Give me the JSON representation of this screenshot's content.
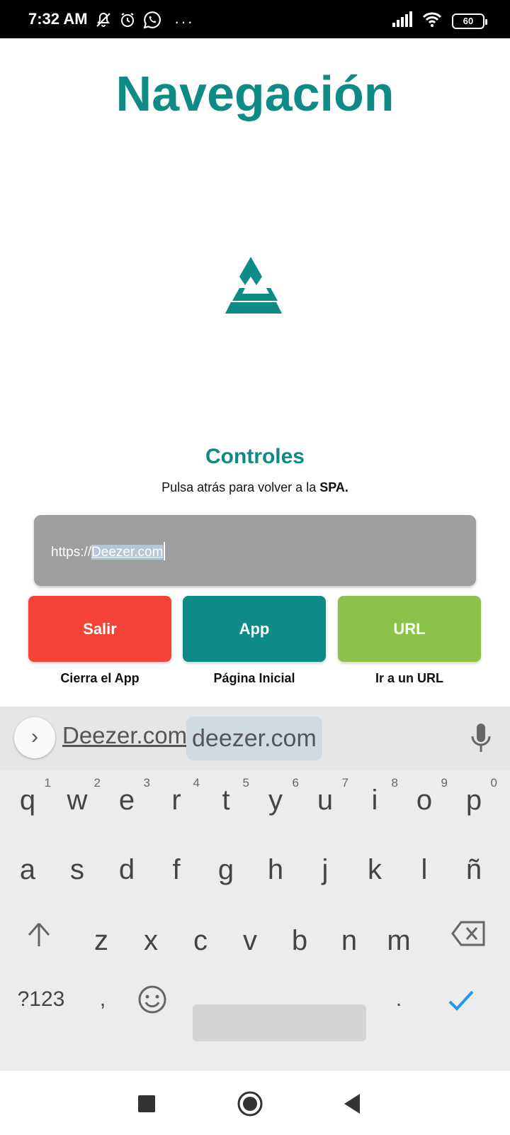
{
  "status_bar": {
    "time": "7:32 AM",
    "battery": "60",
    "icons_left": [
      "mute-bell-icon",
      "alarm-icon",
      "whatsapp-icon",
      "more-dots-icon"
    ],
    "icons_right": [
      "signal-icon",
      "wifi-icon",
      "battery-icon"
    ],
    "more": "···"
  },
  "page": {
    "title": "Navegación",
    "section_title": "Controles",
    "hint_prefix": "Pulsa atrás para volver a la ",
    "hint_bold": "SPA.",
    "colors": {
      "brand": "#0e8b87",
      "danger": "#f44336",
      "success": "#8bc34a",
      "field": "#9e9e9e"
    }
  },
  "url_input": {
    "prefix": "https://",
    "selected": "Deezer.com"
  },
  "buttons": [
    {
      "label": "Salir",
      "caption": "Cierra el App"
    },
    {
      "label": "App",
      "caption": "Página Inicial"
    },
    {
      "label": "URL",
      "caption": "Ir a un URL"
    }
  ],
  "keyboard": {
    "suggestions": [
      "Deezer.com",
      "deezer.com"
    ],
    "row1": [
      {
        "k": "q",
        "n": "1"
      },
      {
        "k": "w",
        "n": "2"
      },
      {
        "k": "e",
        "n": "3"
      },
      {
        "k": "r",
        "n": "4"
      },
      {
        "k": "t",
        "n": "5"
      },
      {
        "k": "y",
        "n": "6"
      },
      {
        "k": "u",
        "n": "7"
      },
      {
        "k": "i",
        "n": "8"
      },
      {
        "k": "o",
        "n": "9"
      },
      {
        "k": "p",
        "n": "0"
      }
    ],
    "row2": [
      "a",
      "s",
      "d",
      "f",
      "g",
      "h",
      "j",
      "k",
      "l",
      "ñ"
    ],
    "row3": [
      "z",
      "x",
      "c",
      "v",
      "b",
      "n",
      "m"
    ],
    "symbols_label": "?123",
    "comma": ",",
    "period": "."
  }
}
